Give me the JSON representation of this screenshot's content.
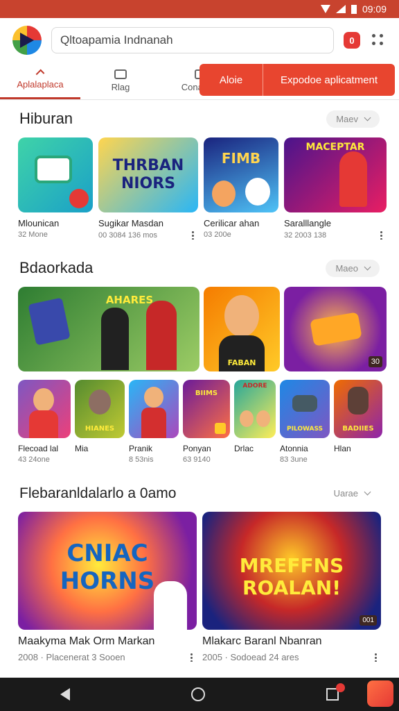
{
  "status": {
    "time": "09:09"
  },
  "header": {
    "search_value": "Qltoapamia Indnanah",
    "notification_count": "0"
  },
  "tabs": [
    {
      "label": "Aplalaplaca"
    },
    {
      "label": "Rlag"
    },
    {
      "label": "Conantan"
    }
  ],
  "tab_buttons": {
    "left": "Aloie",
    "right": "Expodoe aplicatment"
  },
  "section1": {
    "title": "Hiburan",
    "more": "Maev",
    "apps": [
      {
        "name": "Mlounican",
        "meta": "32 Mone",
        "thumb_text": ""
      },
      {
        "name": "Sugikar Masdan",
        "meta": "00 3084 136 mos",
        "thumb_text": "THRBAN NIORS"
      },
      {
        "name": "Cerilicar ahan",
        "meta": "03 200e",
        "thumb_text": "FIMB"
      },
      {
        "name": "Saralllangle",
        "meta": "32 2003 138",
        "thumb_text": "MACEPTAR"
      }
    ]
  },
  "section2": {
    "title": "Bdaorkada",
    "more": "Maeo",
    "banners": [
      {
        "thumb_text": "AHARES"
      },
      {
        "thumb_text": "FABAN"
      },
      {
        "thumb_text": "30"
      }
    ],
    "apps": [
      {
        "name": "Flecoad lal",
        "meta": "43 24one",
        "thumb_text": ""
      },
      {
        "name": "Mia",
        "meta": "",
        "thumb_text": "HIANES"
      },
      {
        "name": "Pranik",
        "meta": "8 53nis",
        "thumb_text": ""
      },
      {
        "name": "Ponyan",
        "meta": "63 9140",
        "thumb_text": "BIIMS"
      },
      {
        "name": "Drlac",
        "meta": "",
        "thumb_text": "ADORE"
      },
      {
        "name": "Atonnia",
        "meta": "83 3une",
        "thumb_text": "PILOWASS"
      },
      {
        "name": "Hlan",
        "meta": "",
        "thumb_text": "BADIIES"
      }
    ]
  },
  "section3": {
    "title": "Flebaranldalarlo a 0amo",
    "more": "Uarae",
    "cards": [
      {
        "name": "Maakyma Mak Orm Markan",
        "meta": "2008 · Placenerat 3 Sooen",
        "thumb_text": "CNIAC HORNS"
      },
      {
        "name": "Mlakarc Baranl Nbanran",
        "meta": "2005 · Sodoead 24 ares",
        "thumb_text": "MREFFNS ROALAN!",
        "badge": "001"
      }
    ]
  },
  "colors": {
    "accent": "#e8452f",
    "status_bar": "#c8432e",
    "nav_bar": "#1a1a1a"
  }
}
